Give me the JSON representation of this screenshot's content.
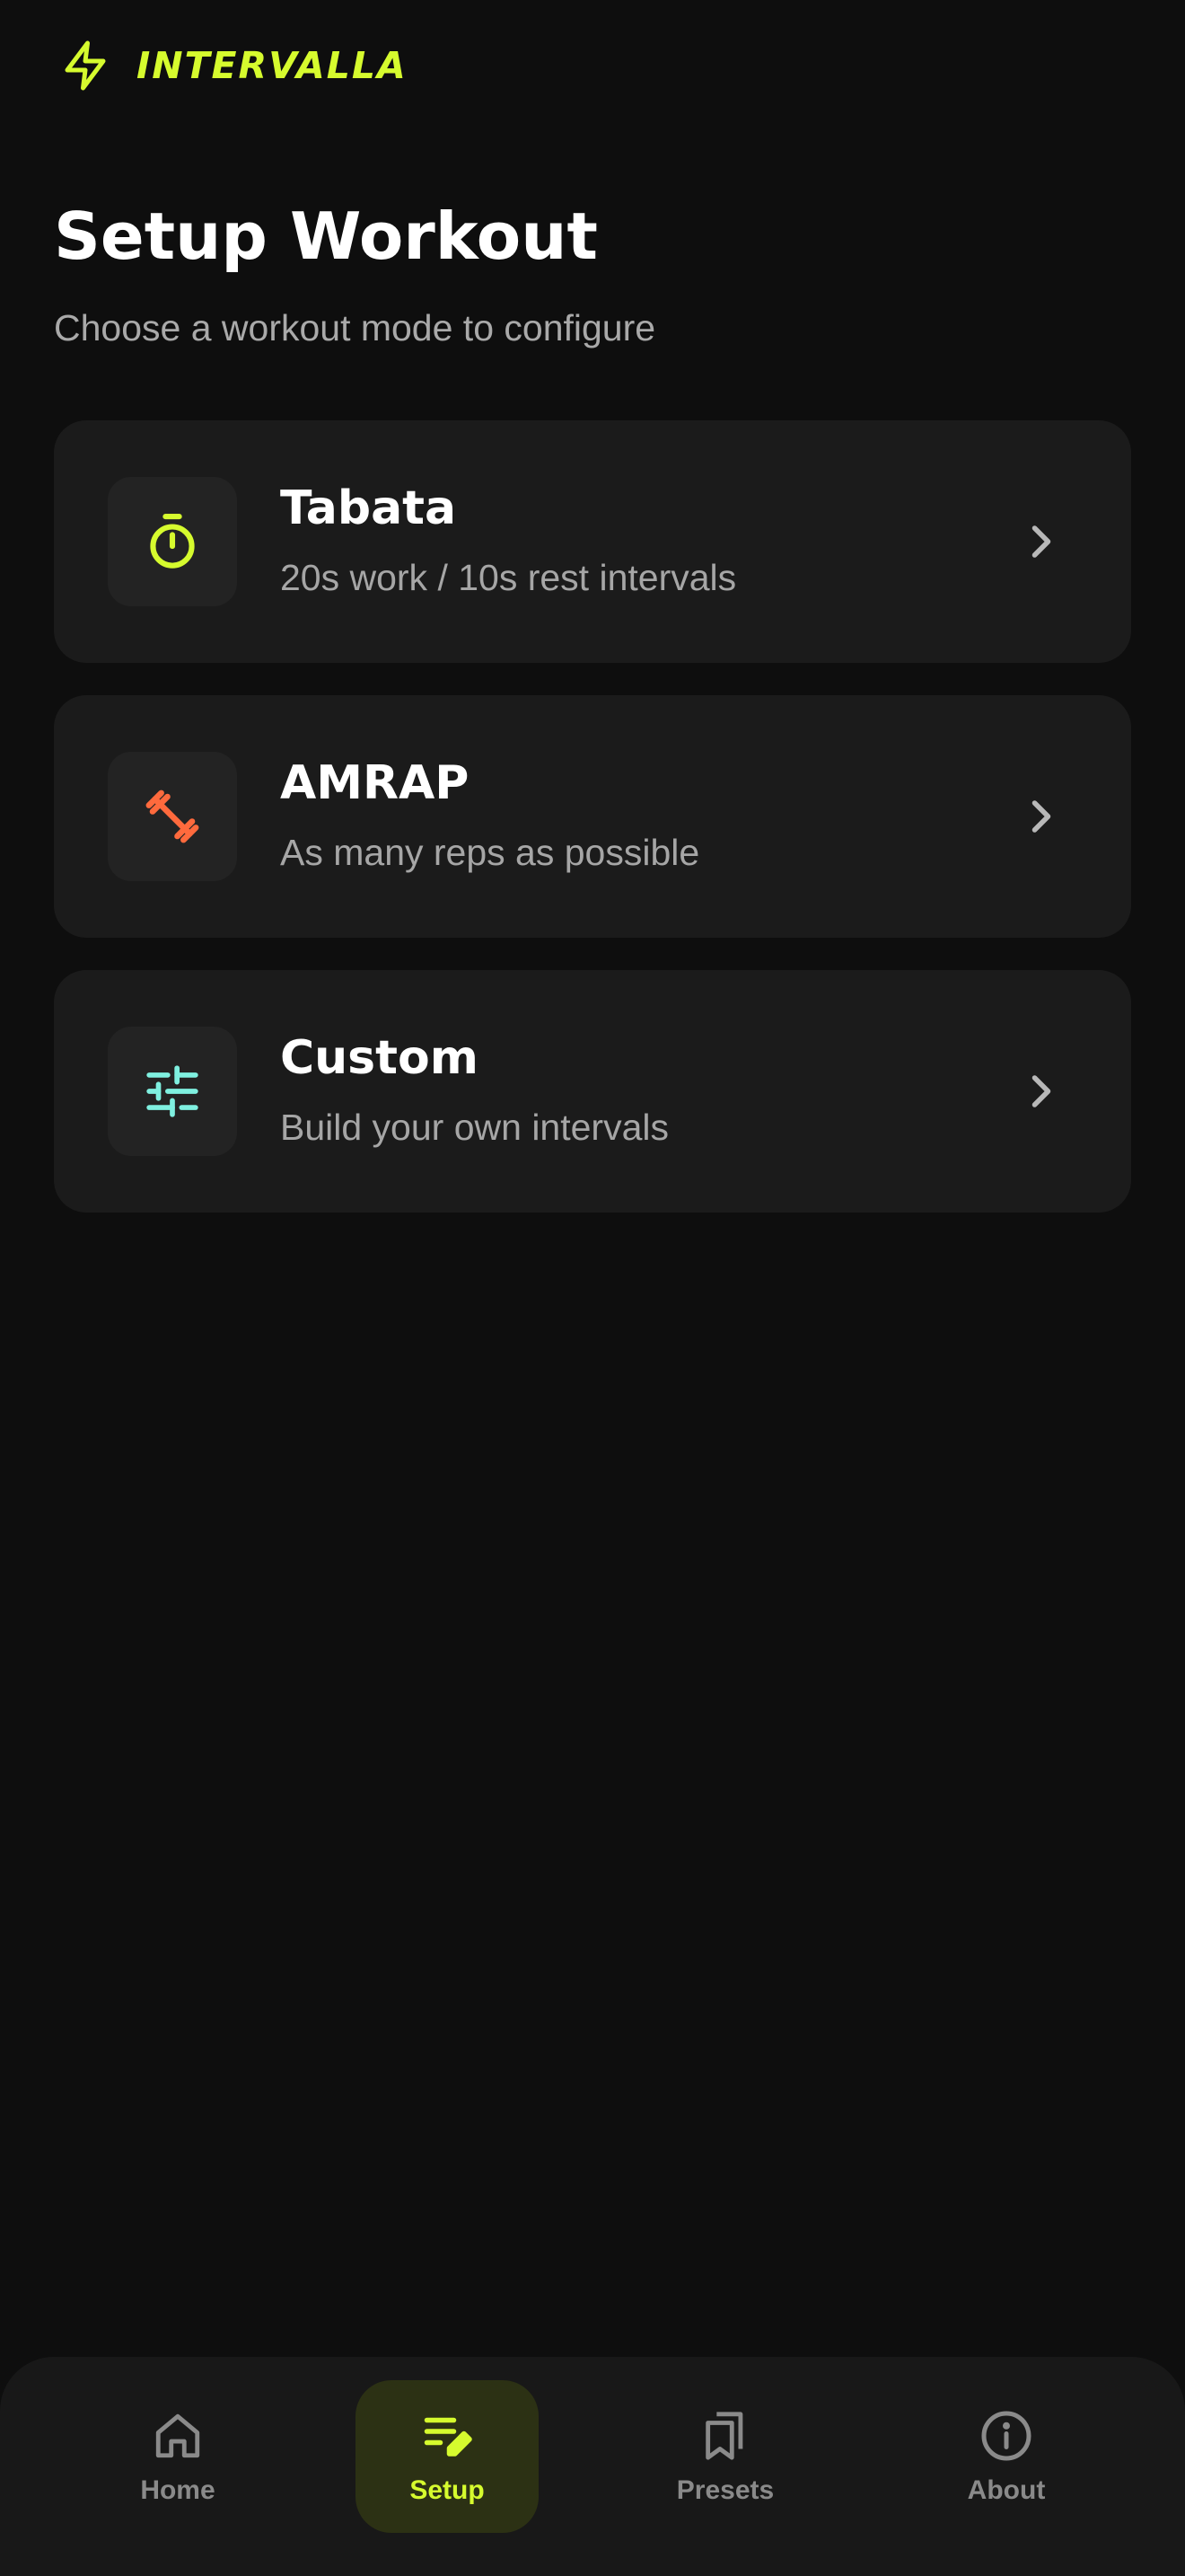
{
  "app": {
    "brand": "INTERVALLA"
  },
  "header": {
    "title": "Setup Workout",
    "subtitle": "Choose a workout mode to configure"
  },
  "modes": [
    {
      "title": "Tabata",
      "description": "20s work / 10s rest intervals",
      "icon": "stopwatch-icon",
      "color": "#d6fb2e"
    },
    {
      "title": "AMRAP",
      "description": "As many reps as possible",
      "icon": "dumbbell-icon",
      "color": "#ff6a3d"
    },
    {
      "title": "Custom",
      "description": "Build your own intervals",
      "icon": "sliders-icon",
      "color": "#7ff0e0"
    }
  ],
  "nav": {
    "items": [
      {
        "label": "Home",
        "icon": "home-icon",
        "active": false
      },
      {
        "label": "Setup",
        "icon": "setup-edit-icon",
        "active": true
      },
      {
        "label": "Presets",
        "icon": "bookmarks-icon",
        "active": false
      },
      {
        "label": "About",
        "icon": "info-icon",
        "active": false
      }
    ]
  },
  "colors": {
    "accent": "#d6fb2e",
    "background": "#0e0e0e",
    "card": "#1b1b1b",
    "nav_active_bg": "#2c3114"
  }
}
